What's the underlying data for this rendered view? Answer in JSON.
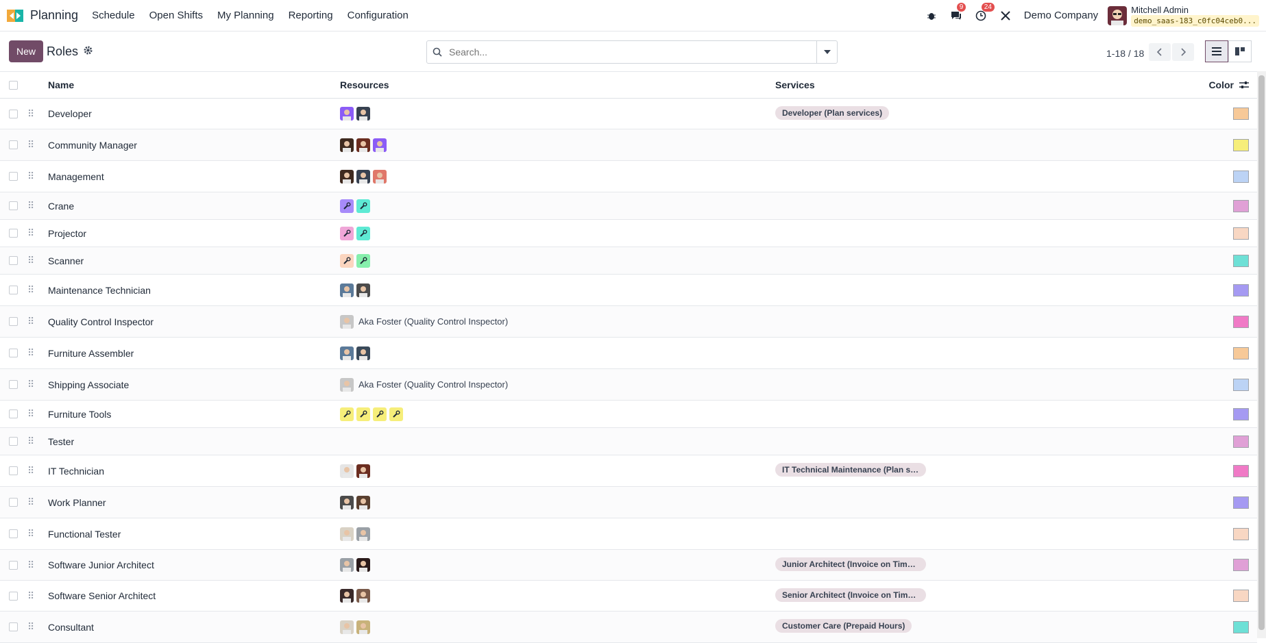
{
  "app": {
    "name": "Planning",
    "menu": [
      "Schedule",
      "Open Shifts",
      "My Planning",
      "Reporting",
      "Configuration"
    ],
    "badges": {
      "chat": "9",
      "activity": "24"
    },
    "company": "Demo Company",
    "user": {
      "name": "Mitchell Admin",
      "db": "demo_saas-183_c0fc04ceb0..."
    }
  },
  "control": {
    "new_label": "New",
    "title": "Roles",
    "search_placeholder": "Search...",
    "pager": "1-18 / 18"
  },
  "columns": {
    "name": "Name",
    "resources": "Resources",
    "services": "Services",
    "color": "Color"
  },
  "rows": [
    {
      "name": "Developer",
      "services": "Developer (Plan services)",
      "color": "#f7c998",
      "res": [
        "a:#8b5cf6",
        "a:#374151"
      ]
    },
    {
      "name": "Community Manager",
      "services": "",
      "color": "#f6ee7a",
      "res": [
        "a:#3f2a1f",
        "a:#6b2d20",
        "a:#8b5cf6"
      ]
    },
    {
      "name": "Management",
      "services": "",
      "color": "#bcd3f5",
      "res": [
        "a:#3f2a1f",
        "a:#374151",
        "a:#e0786a"
      ]
    },
    {
      "name": "Crane",
      "services": "",
      "color": "#e0a0d6",
      "res": [
        "t:#a78bfa",
        "t:#5eead4"
      ]
    },
    {
      "name": "Projector",
      "services": "",
      "color": "#f8d7c3",
      "res": [
        "t:#f0a6d8",
        "t:#5eead4"
      ]
    },
    {
      "name": "Scanner",
      "services": "",
      "color": "#6ee0d6",
      "res": [
        "t:#fbd5bf",
        "t:#86efac"
      ]
    },
    {
      "name": "Maintenance Technician",
      "services": "",
      "color": "#a59af2",
      "res": [
        "a:#5b7a99",
        "a:#4b4b4b"
      ]
    },
    {
      "name": "Quality Control Inspector",
      "services": "",
      "color": "#f07ac6",
      "res": [
        "a:#c7c7c7"
      ],
      "res_text": "Aka Foster (Quality Control Inspector)"
    },
    {
      "name": "Furniture Assembler",
      "services": "",
      "color": "#f7c998",
      "res": [
        "a:#5b7a99",
        "a:#3a4a5a"
      ]
    },
    {
      "name": "Shipping Associate",
      "services": "",
      "color": "#bcd3f5",
      "res": [
        "a:#c7c7c7"
      ],
      "res_text": "Aka Foster (Quality Control Inspector)"
    },
    {
      "name": "Furniture Tools",
      "services": "",
      "color": "#a59af2",
      "res": [
        "t:#f6ee7a",
        "t:#f6ee7a",
        "t:#f6ee7a",
        "t:#f6ee7a"
      ]
    },
    {
      "name": "Tester",
      "services": "",
      "color": "#e0a0d6",
      "res": []
    },
    {
      "name": "IT Technician",
      "services": "IT Technical Maintenance (Plan se...",
      "color": "#f07ac6",
      "res": [
        "a:#e5e5e5",
        "a:#6b2d20"
      ]
    },
    {
      "name": "Work Planner",
      "services": "",
      "color": "#a59af2",
      "res": [
        "a:#4b4b4b",
        "a:#5a4030"
      ]
    },
    {
      "name": "Functional Tester",
      "services": "",
      "color": "#f8d7c3",
      "res": [
        "a:#d9d2c5",
        "a:#9aa0a6"
      ]
    },
    {
      "name": "Software Junior Architect",
      "services": "Junior Architect (Invoice on Times...",
      "color": "#e0a0d6",
      "res": [
        "a:#9aa0a6",
        "a:#2a1a1a"
      ]
    },
    {
      "name": "Software Senior Architect",
      "services": "Senior Architect (Invoice on Times...",
      "color": "#f8d7c3",
      "res": [
        "a:#3a2a2a",
        "a:#7a5a4a"
      ]
    },
    {
      "name": "Consultant",
      "services": "Customer Care (Prepaid Hours)",
      "color": "#6ee0d6",
      "res": [
        "a:#d9d2c5",
        "a:#c8b27a"
      ]
    }
  ]
}
